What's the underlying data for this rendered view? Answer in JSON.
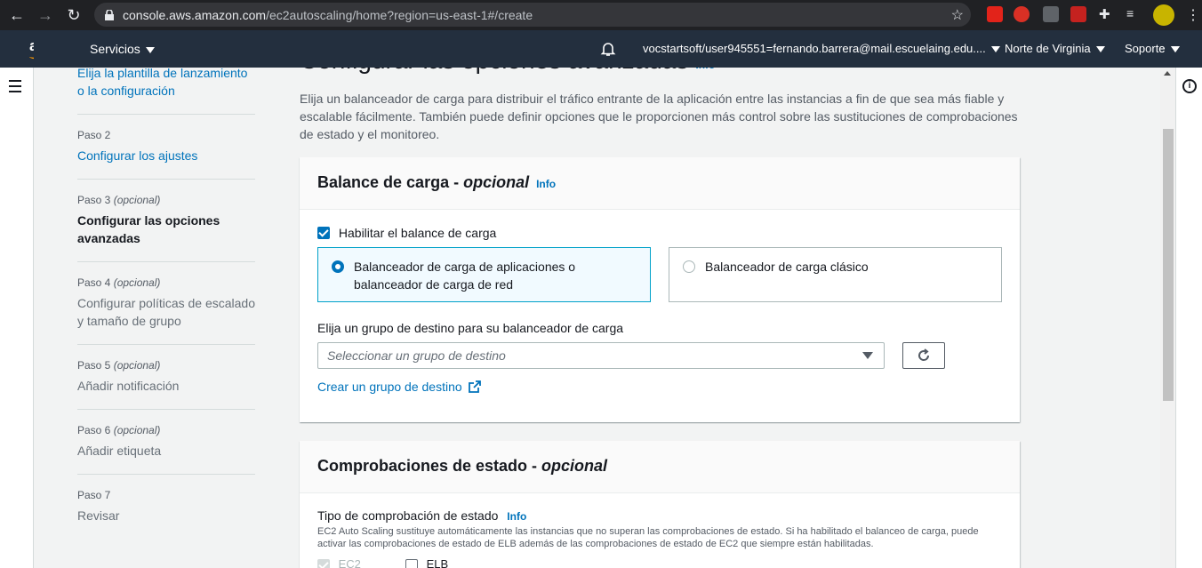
{
  "browser": {
    "url_host": "console.aws.amazon.com",
    "url_path": "/ec2autoscaling/home?region=us-east-1#/create"
  },
  "header": {
    "logo": "aws",
    "services": "Servicios",
    "account": "vocstartsoft/user945551=fernando.barrera@mail.escuelaing.edu....",
    "region": "Norte de Virginia",
    "support": "Soporte"
  },
  "wizard": {
    "step1_title": "Elija la plantilla de lanzamiento o la configuración",
    "steps": [
      {
        "num": "Paso 2",
        "opt": "",
        "title": "Configurar los ajustes"
      },
      {
        "num": "Paso 3",
        "opt": "(opcional)",
        "title": "Configurar las opciones avanzadas"
      },
      {
        "num": "Paso 4",
        "opt": "(opcional)",
        "title": "Configurar políticas de escalado y tamaño de grupo"
      },
      {
        "num": "Paso 5",
        "opt": "(opcional)",
        "title": "Añadir notificación"
      },
      {
        "num": "Paso 6",
        "opt": "(opcional)",
        "title": "Añadir etiqueta"
      },
      {
        "num": "Paso 7",
        "opt": "",
        "title": "Revisar"
      }
    ]
  },
  "main": {
    "title": "Configurar las opciones avanzadas",
    "title_info": "Info",
    "description": "Elija un balanceador de carga para distribuir el tráfico entrante de la aplicación entre las instancias a fin de que sea más fiable y escalable fácilmente. También puede definir opciones que le proporcionen más control sobre las sustituciones de comprobaciones de estado y el monitoreo."
  },
  "lb_panel": {
    "title": "Balance de carga - ",
    "title_opt": "opcional",
    "info": "Info",
    "enable_label": "Habilitar el balance de carga",
    "tile_app": "Balanceador de carga de aplicaciones o balanceador de carga de red",
    "tile_classic": "Balanceador de carga clásico",
    "target_label": "Elija un grupo de destino para su balanceador de carga",
    "target_placeholder": "Seleccionar un grupo de destino",
    "create_link": "Crear un grupo de destino"
  },
  "health_panel": {
    "title": "Comprobaciones de estado - ",
    "title_opt": "opcional",
    "type_label": "Tipo de comprobación de estado",
    "info": "Info",
    "help": "EC2 Auto Scaling sustituye automáticamente las instancias que no superan las comprobaciones de estado. Si ha habilitado el balanceo de carga, puede activar las comprobaciones de estado de ELB además de las comprobaciones de estado de EC2 que siempre están habilitadas.",
    "ec2": "EC2",
    "elb": "ELB"
  }
}
